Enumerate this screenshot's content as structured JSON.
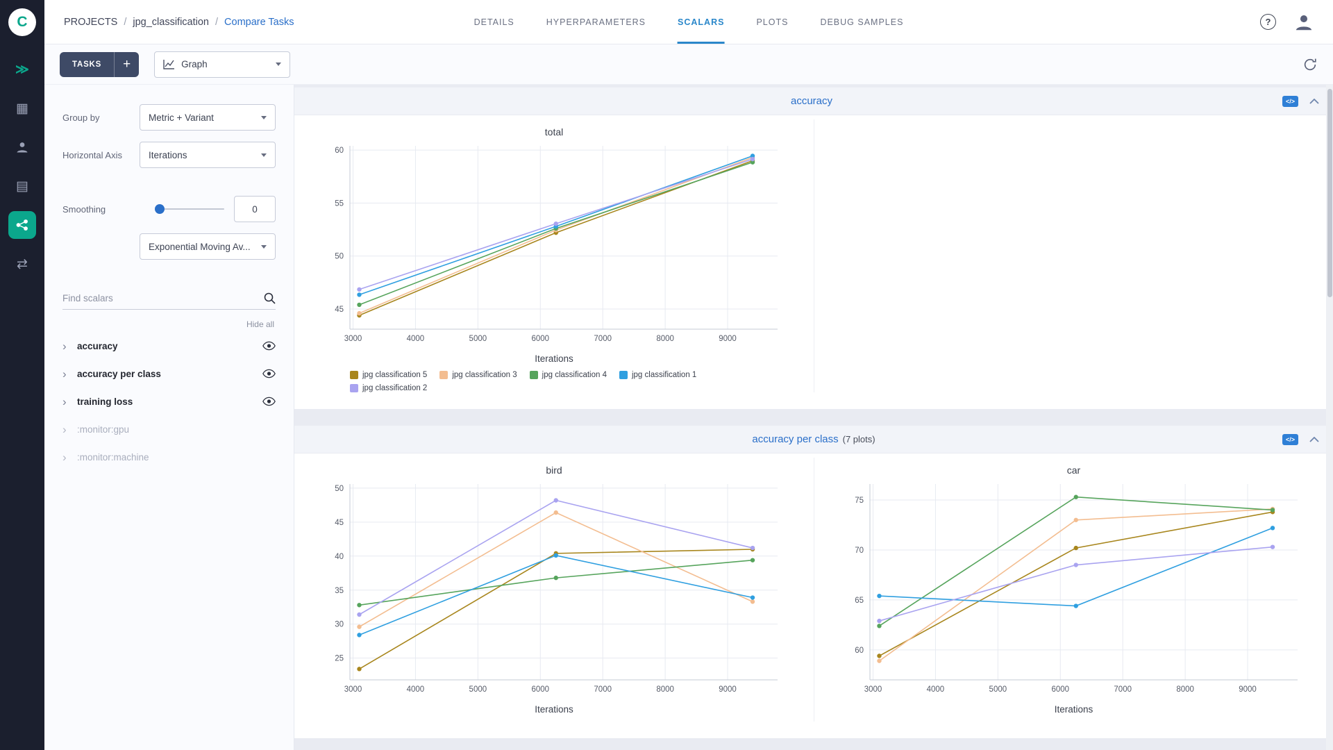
{
  "colors": {
    "accent_blue": "#2a6fc9",
    "tab_blue": "#2a87ca",
    "accent_teal": "#0ba78c",
    "rail_bg": "#1b1f2e"
  },
  "icons": {
    "logo_letter": "C",
    "getting_started": "≫",
    "projects": "▦",
    "datasets": "▤",
    "pipelines": "⇄",
    "question": "?",
    "plus": "+",
    "embed_code": "</>"
  },
  "header": {
    "breadcrumb": {
      "root": "PROJECTS",
      "separator": "/",
      "project": "jpg_classification",
      "page": "Compare Tasks"
    },
    "tabs": [
      {
        "label": "DETAILS"
      },
      {
        "label": "HYPERPARAMETERS"
      },
      {
        "label": "SCALARS"
      },
      {
        "label": "PLOTS"
      },
      {
        "label": "DEBUG SAMPLES"
      }
    ],
    "active_tab": "SCALARS"
  },
  "toolbar": {
    "tasks_label": "TASKS",
    "view_value": "Graph"
  },
  "controls": {
    "group_by_label": "Group by",
    "group_by_value": "Metric + Variant",
    "horizontal_axis_label": "Horizontal Axis",
    "horizontal_axis_value": "Iterations",
    "smoothing_label": "Smoothing",
    "smoothing_value": "0",
    "smoothing_method": "Exponential Moving Av...",
    "find_placeholder": "Find scalars",
    "hide_all_label": "Hide all",
    "metrics": [
      {
        "label": "accuracy",
        "muted": false
      },
      {
        "label": "accuracy per class",
        "muted": false
      },
      {
        "label": "training loss",
        "muted": false
      },
      {
        "label": ":monitor:gpu",
        "muted": true
      },
      {
        "label": ":monitor:machine",
        "muted": true
      }
    ]
  },
  "sections": [
    {
      "title": "accuracy",
      "plots_note": ""
    },
    {
      "title": "accuracy per class",
      "plots_note": "(7 plots)"
    }
  ],
  "chart_data": [
    {
      "type": "line",
      "title": "total",
      "xlabel": "Iterations",
      "legend": true,
      "x": [
        3100,
        6250,
        9400
      ],
      "xticks": [
        3000,
        4000,
        5000,
        6000,
        7000,
        8000,
        9000
      ],
      "yticks": [
        45,
        50,
        55,
        60
      ],
      "xlim": [
        2950,
        9800
      ],
      "ylim": [
        43.1,
        60.4
      ],
      "series": [
        {
          "name": "jpg classification 5",
          "color": "#a8861d",
          "values": [
            44.4,
            52.2,
            59.0
          ]
        },
        {
          "name": "jpg classification 3",
          "color": "#f3bd90",
          "values": [
            44.6,
            52.45,
            59.3
          ]
        },
        {
          "name": "jpg classification 4",
          "color": "#56a45c",
          "values": [
            45.4,
            52.6,
            58.85
          ]
        },
        {
          "name": "jpg classification 1",
          "color": "#2f9fe0",
          "values": [
            46.35,
            52.8,
            59.45
          ]
        },
        {
          "name": "jpg classification 2",
          "color": "#a9a3f0",
          "values": [
            46.85,
            53.05,
            59.15
          ]
        }
      ]
    },
    {
      "type": "line",
      "title": "bird",
      "xlabel": "Iterations",
      "legend": false,
      "x": [
        3100,
        6250,
        9400
      ],
      "xticks": [
        3000,
        4000,
        5000,
        6000,
        7000,
        8000,
        9000
      ],
      "yticks": [
        25,
        30,
        35,
        40,
        45,
        50
      ],
      "xlim": [
        2950,
        9800
      ],
      "ylim": [
        21.8,
        50.6
      ],
      "series": [
        {
          "name": "jpg classification 5",
          "color": "#a8861d",
          "values": [
            23.4,
            40.4,
            41.0
          ]
        },
        {
          "name": "jpg classification 3",
          "color": "#f3bd90",
          "values": [
            29.6,
            46.4,
            33.3
          ]
        },
        {
          "name": "jpg classification 4",
          "color": "#56a45c",
          "values": [
            32.8,
            36.8,
            39.4
          ]
        },
        {
          "name": "jpg classification 1",
          "color": "#2f9fe0",
          "values": [
            28.4,
            40.1,
            33.9
          ]
        },
        {
          "name": "jpg classification 2",
          "color": "#a9a3f0",
          "values": [
            31.4,
            48.2,
            41.2
          ]
        }
      ]
    },
    {
      "type": "line",
      "title": "car",
      "xlabel": "Iterations",
      "legend": false,
      "x": [
        3100,
        6250,
        9400
      ],
      "xticks": [
        3000,
        4000,
        5000,
        6000,
        7000,
        8000,
        9000
      ],
      "yticks": [
        60,
        65,
        70,
        75
      ],
      "xlim": [
        2950,
        9800
      ],
      "ylim": [
        57.0,
        76.6
      ],
      "series": [
        {
          "name": "jpg classification 5",
          "color": "#a8861d",
          "values": [
            59.4,
            70.2,
            73.8
          ]
        },
        {
          "name": "jpg classification 3",
          "color": "#f3bd90",
          "values": [
            58.9,
            73.0,
            74.1
          ]
        },
        {
          "name": "jpg classification 4",
          "color": "#56a45c",
          "values": [
            62.4,
            75.3,
            74.0
          ]
        },
        {
          "name": "jpg classification 1",
          "color": "#2f9fe0",
          "values": [
            65.4,
            64.4,
            72.2
          ]
        },
        {
          "name": "jpg classification 2",
          "color": "#a9a3f0",
          "values": [
            62.9,
            68.5,
            70.3
          ]
        }
      ]
    }
  ]
}
